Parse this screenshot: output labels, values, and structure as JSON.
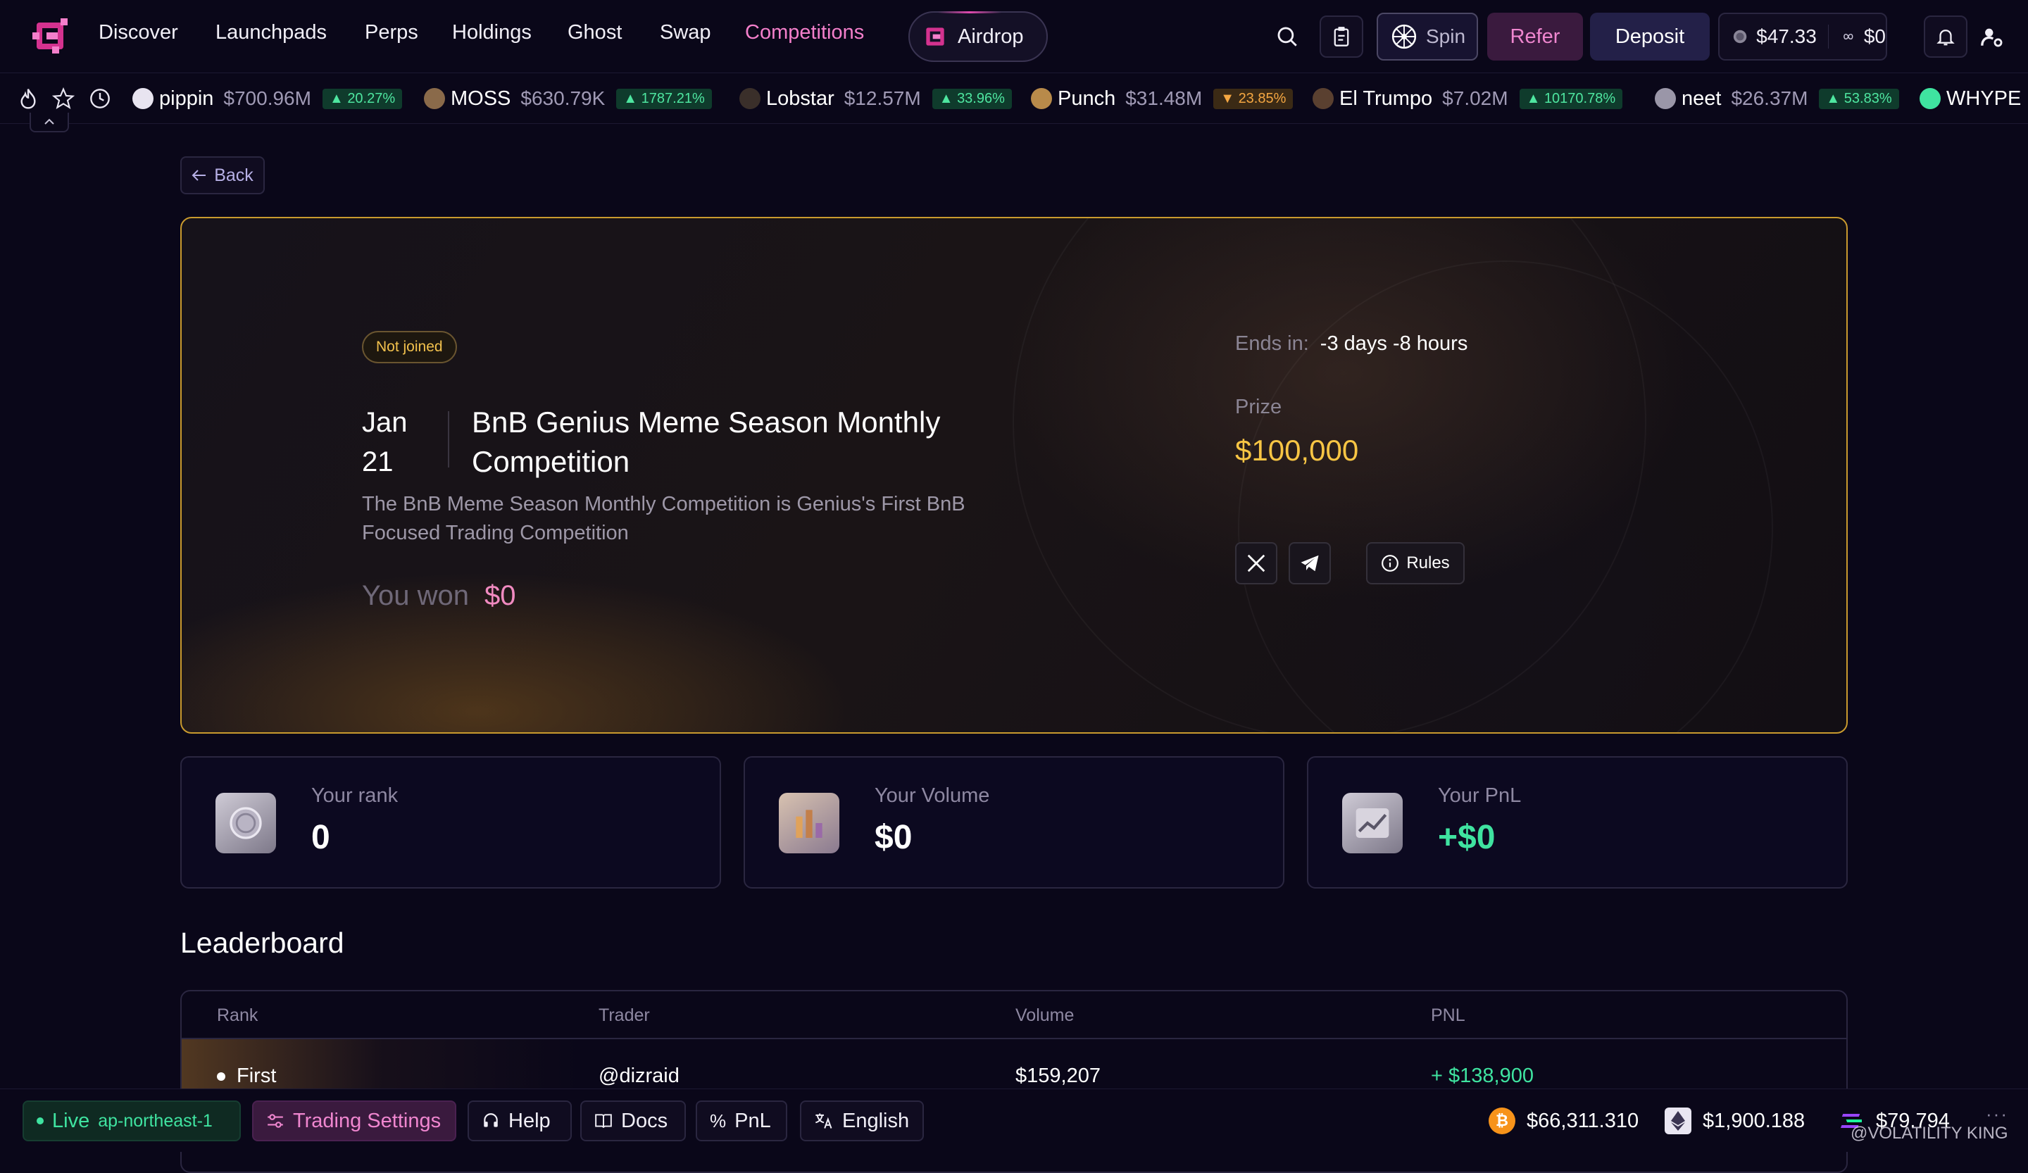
{
  "nav": {
    "items": [
      "Discover",
      "Launchpads",
      "Perps",
      "Holdings",
      "Ghost",
      "Swap",
      "Competitions"
    ],
    "active": "Competitions",
    "airdrop_label": "Airdrop",
    "spin_label": "Spin",
    "refer_label": "Refer",
    "deposit_label": "Deposit",
    "balance": "$47.33",
    "balance_secondary": "$0"
  },
  "ticker": [
    {
      "name": "pippin",
      "mcap": "$700.96M",
      "change": "20.27%",
      "dir": "up",
      "color": "#e8e4f0"
    },
    {
      "name": "MOSS",
      "mcap": "$630.79K",
      "change": "1787.21%",
      "dir": "up",
      "color": "#8a6a4a"
    },
    {
      "name": "Lobstar",
      "mcap": "$12.57M",
      "change": "33.96%",
      "dir": "up",
      "color": "#3a2f2a"
    },
    {
      "name": "Punch",
      "mcap": "$31.48M",
      "change": "23.85%",
      "dir": "down",
      "color": "#b88a4a"
    },
    {
      "name": "El Trumpo",
      "mcap": "$7.02M",
      "change": "10170.78%",
      "dir": "up",
      "color": "#5a4030"
    },
    {
      "name": "neet",
      "mcap": "$26.37M",
      "change": "53.83%",
      "dir": "up",
      "color": "#9a96a8"
    },
    {
      "name": "WHYPE",
      "mcap": "",
      "change": "",
      "dir": "up",
      "color": "#3fe3a0"
    }
  ],
  "back_label": "Back",
  "competition": {
    "status": "Not joined",
    "month": "Jan",
    "day": "21",
    "title": "BnB Genius Meme Season Monthly Competition",
    "description": "The BnB Meme Season Monthly Competition is Genius's First BnB Focused Trading Competition",
    "won_label": "You won",
    "won_value": "$0",
    "ends_label": "Ends in:",
    "ends_value": "-3 days -8 hours",
    "prize_label": "Prize",
    "prize_value": "$100,000",
    "rules_label": "Rules"
  },
  "stats": [
    {
      "label": "Your rank",
      "value": "0"
    },
    {
      "label": "Your Volume",
      "value": "$0"
    },
    {
      "label": "Your PnL",
      "value": "+$0"
    }
  ],
  "leaderboard": {
    "title": "Leaderboard",
    "columns": [
      "Rank",
      "Trader",
      "Volume",
      "PNL"
    ],
    "rows": [
      {
        "rank": "First",
        "trader": "@dizraid",
        "volume": "$159,207",
        "pnl": "+ $138,900"
      }
    ]
  },
  "footer": {
    "live_label": "Live",
    "region": "ap-northeast-1",
    "trading_settings": "Trading Settings",
    "help": "Help",
    "docs": "Docs",
    "pnl": "PnL",
    "language": "English",
    "btc_price": "$66,311.310",
    "eth_price": "$1,900.188",
    "sol_price": "$79.794",
    "watermark": "@VOLATILITY KING"
  },
  "colors": {
    "accent_pink": "#f47fcb",
    "gold": "#f7c544",
    "green": "#3fe3a0",
    "background": "#0a0719"
  }
}
